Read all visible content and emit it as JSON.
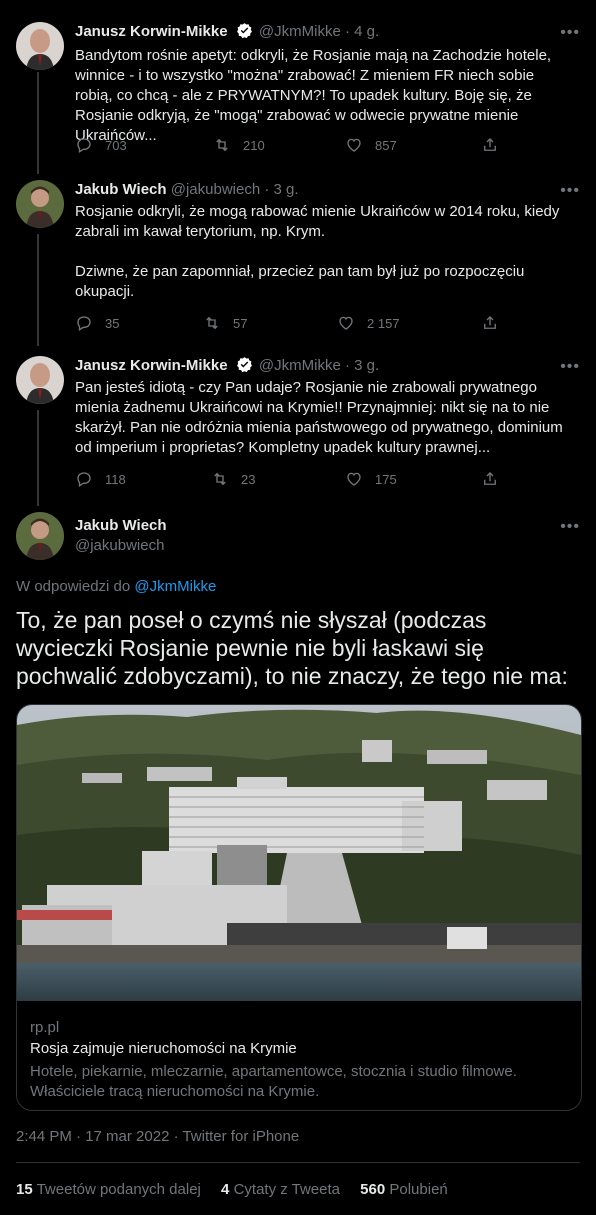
{
  "tweets": [
    {
      "name": "Janusz Korwin-Mikke",
      "handle": "@JkmMikke",
      "time": "· 4 g.",
      "text": "Bandytom rośnie apetyt: odkryli, że Rosjanie mają na Zachodzie hotele, winnice - i to wszystko \"można\" zrabować! Z mieniem FR niech sobie robią, co chcą - ale z PRYWATNYM?! To upadek kultury. Boję się, że Rosjanie odkryją, że \"mogą\" zrabować w odwecie prywatne mienie Ukraińców...",
      "replies": "703",
      "retweets": "210",
      "likes": "857"
    },
    {
      "name": "Jakub Wiech",
      "handle": "@jakubwiech",
      "time": "· 3 g.",
      "text1": "Rosjanie odkryli, że mogą rabować mienie Ukraińców w 2014 roku, kiedy zabrali im kawał terytorium, np. Krym.",
      "text2": "Dziwne, że pan zapomniał, przecież pan tam był już po rozpoczęciu okupacji.",
      "replies": "35",
      "retweets": "57",
      "likes": "2 157"
    },
    {
      "name": "Janusz Korwin-Mikke",
      "handle": "@JkmMikke",
      "time": "· 3 g.",
      "text": "Pan jesteś idiotą - czy Pan udaje? Rosjanie nie zrabowali prywatnego mienia żadnemu Ukraińcowi na Krymie!! Przynajmniej: nikt się na to nie skarżył. Pan nie odróżnia mienia państwowego od prywatnego, dominium od imperium i proprietas? Kompletny upadek kultury prawnej...",
      "replies": "118",
      "retweets": "23",
      "likes": "175"
    }
  ],
  "main": {
    "name": "Jakub Wiech",
    "handle": "@jakubwiech",
    "reply_prefix": "W odpowiedzi do ",
    "reply_to": "@JkmMikke",
    "text": "To, że pan poseł o czymś nie słyszał (podczas wycieczki Rosjanie pewnie nie byli łaskawi się pochwalić zdobyczami), to nie znaczy, że tego nie ma:",
    "card": {
      "domain": "rp.pl",
      "title": "Rosja zajmuje nieruchomości na Krymie",
      "description": "Hotele, piekarnie, mleczarnie, apartamentowce, stocznia i studio filmowe. Właściciele tracą nieruchomości na Krymie."
    },
    "meta": "2:44 PM · 17 mar 2022 · Twitter for iPhone",
    "stats": {
      "retweets_count": "15",
      "retweets_label": "Tweetów podanych dalej",
      "quotes_count": "4",
      "quotes_label": "Cytaty z Tweeta",
      "likes_count": "560",
      "likes_label": "Polubień"
    }
  },
  "colors": {
    "background": "#000000",
    "text": "#e7e9ea",
    "secondary": "#71767b",
    "link": "#1d9bf0",
    "verified": "#ffffff"
  },
  "icons": [
    "reply-icon",
    "retweet-icon",
    "like-icon",
    "share-icon",
    "verified-icon",
    "more-icon"
  ]
}
